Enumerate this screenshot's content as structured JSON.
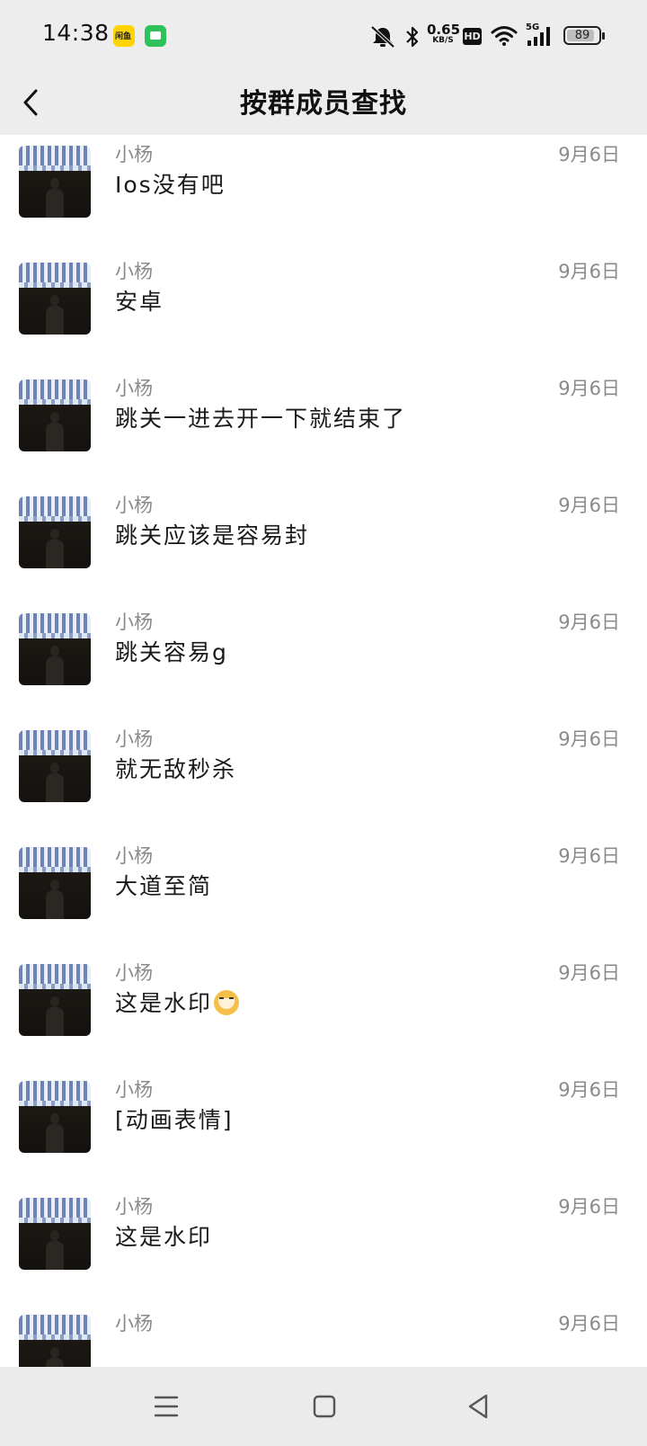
{
  "status_bar": {
    "time": "14:38",
    "net_speed_value": "0.65",
    "net_speed_unit": "KB/S",
    "hd_label": "HD",
    "network_type": "5G",
    "battery": "89",
    "battery_fraction": 0.89,
    "icons": [
      "xianyu-app-icon",
      "chat-app-icon",
      "mute-bell-icon",
      "bluetooth-icon",
      "wifi-icon",
      "cellular-signal-icon",
      "battery-icon"
    ]
  },
  "header": {
    "title": "按群成员查找",
    "back_icon": "chevron-left-icon"
  },
  "messages": [
    {
      "sender": "小杨",
      "date": "9月6日",
      "text": "Ios没有吧"
    },
    {
      "sender": "小杨",
      "date": "9月6日",
      "text": "安卓"
    },
    {
      "sender": "小杨",
      "date": "9月6日",
      "text": "跳关一进去开一下就结束了"
    },
    {
      "sender": "小杨",
      "date": "9月6日",
      "text": "跳关应该是容易封"
    },
    {
      "sender": "小杨",
      "date": "9月6日",
      "text": "跳关容易g"
    },
    {
      "sender": "小杨",
      "date": "9月6日",
      "text": "就无敌秒杀"
    },
    {
      "sender": "小杨",
      "date": "9月6日",
      "text": "大道至简"
    },
    {
      "sender": "小杨",
      "date": "9月6日",
      "text": "这是水印",
      "emoji": "cat-face-emoji"
    },
    {
      "sender": "小杨",
      "date": "9月6日",
      "text": "[动画表情]"
    },
    {
      "sender": "小杨",
      "date": "9月6日",
      "text": "这是水印"
    },
    {
      "sender": "小杨",
      "date": "9月6日",
      "text": ""
    }
  ],
  "nav_bar": {
    "icons": [
      "menu-icon",
      "home-square-icon",
      "back-triangle-icon"
    ]
  }
}
